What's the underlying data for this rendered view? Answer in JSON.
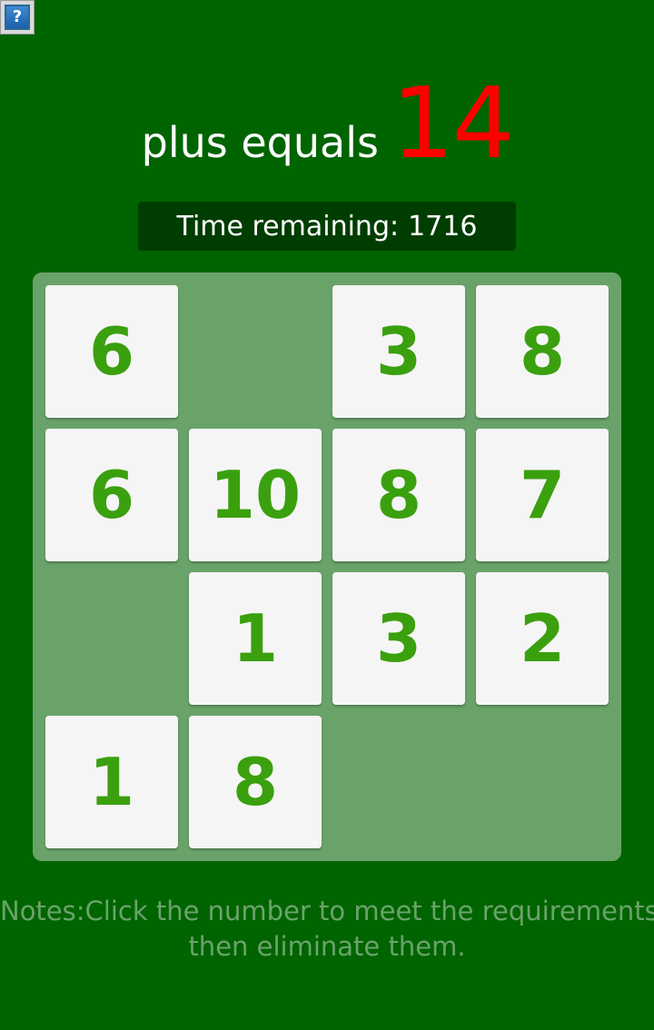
{
  "header": {
    "help_icon": "question-mark",
    "help_glyph": "?",
    "title": "plus equals",
    "target": "14"
  },
  "timer": {
    "label": "Time remaining:",
    "value": "1716"
  },
  "board": {
    "rows": 4,
    "cols": 4,
    "cells": [
      [
        "6",
        null,
        "3",
        "8"
      ],
      [
        "6",
        "10",
        "8",
        "7"
      ],
      [
        null,
        "1",
        "3",
        "2"
      ],
      [
        "1",
        "8",
        null,
        null
      ]
    ]
  },
  "notes": {
    "line1": "Notes:Click the number to meet the requirements",
    "line2": "then eliminate them."
  },
  "colors": {
    "background": "#006400",
    "target": "#ff0000",
    "board": "#6aa36a",
    "tile": "#f5f5f5",
    "tile_text": "#3aa00e",
    "timer_bg": "#003d00",
    "notes_text": "#6aa36a"
  }
}
